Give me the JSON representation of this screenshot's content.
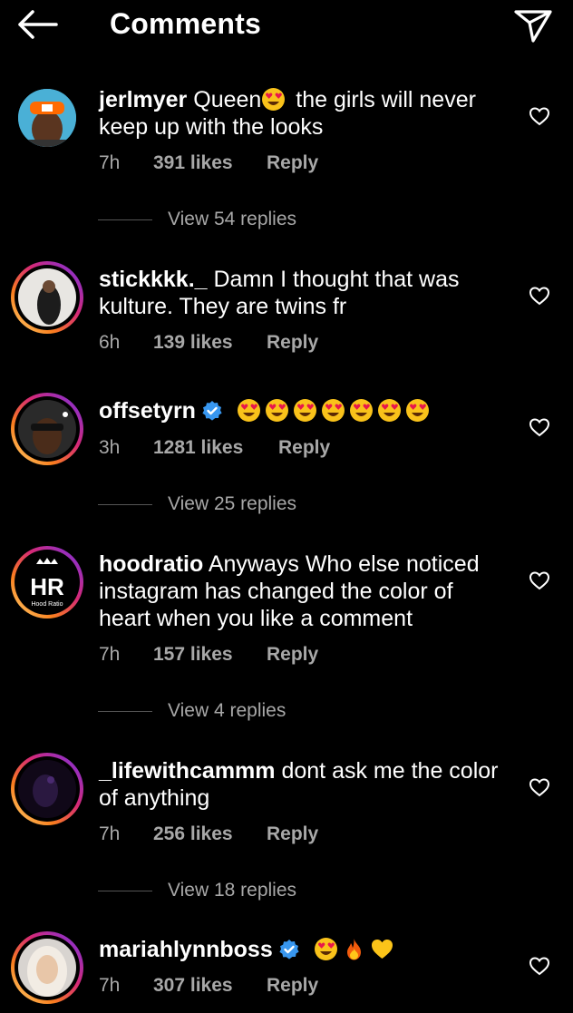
{
  "header": {
    "title": "Comments",
    "back_icon": "arrow-left-icon",
    "share_icon": "paper-plane-icon"
  },
  "comments": [
    {
      "username": "jerlmyer",
      "verified": false,
      "text_lines": [
        "Queen",
        " the girls will never",
        "keep up with the looks"
      ],
      "time": "7h",
      "likes": "391 likes",
      "reply": "Reply",
      "view_replies": "View 54 replies"
    },
    {
      "username": "stickkkk._",
      "verified": false,
      "text_lines": [
        "Damn I thought that was",
        "kulture. They are twins fr"
      ],
      "time": "6h",
      "likes": "139 likes",
      "reply": "Reply"
    },
    {
      "username": "offsetyrn",
      "verified": true,
      "emoji_count": 7,
      "time": "3h",
      "likes": "1281 likes",
      "reply": "Reply",
      "view_replies": "View 25 replies"
    },
    {
      "username": "hoodratio",
      "verified": false,
      "text_lines": [
        "Anyways Who else noticed",
        "instagram has changed the color of",
        "heart when you like a comment"
      ],
      "time": "7h",
      "likes": "157 likes",
      "reply": "Reply",
      "view_replies": "View 4 replies",
      "avatar_text": "HR",
      "avatar_subtext": "Hood Ratio"
    },
    {
      "username": "_lifewithcammm",
      "verified": false,
      "text_lines": [
        "dont ask me the color",
        "of anything"
      ],
      "time": "7h",
      "likes": "256 likes",
      "reply": "Reply",
      "view_replies": "View 18 replies"
    },
    {
      "username": "mariahlynnboss",
      "verified": true,
      "time": "7h",
      "likes": "307 likes",
      "reply": "Reply"
    }
  ],
  "colors": {
    "background": "#000000",
    "text": "#ffffff",
    "muted": "#a8a8a8",
    "verified": "#3897f0"
  }
}
